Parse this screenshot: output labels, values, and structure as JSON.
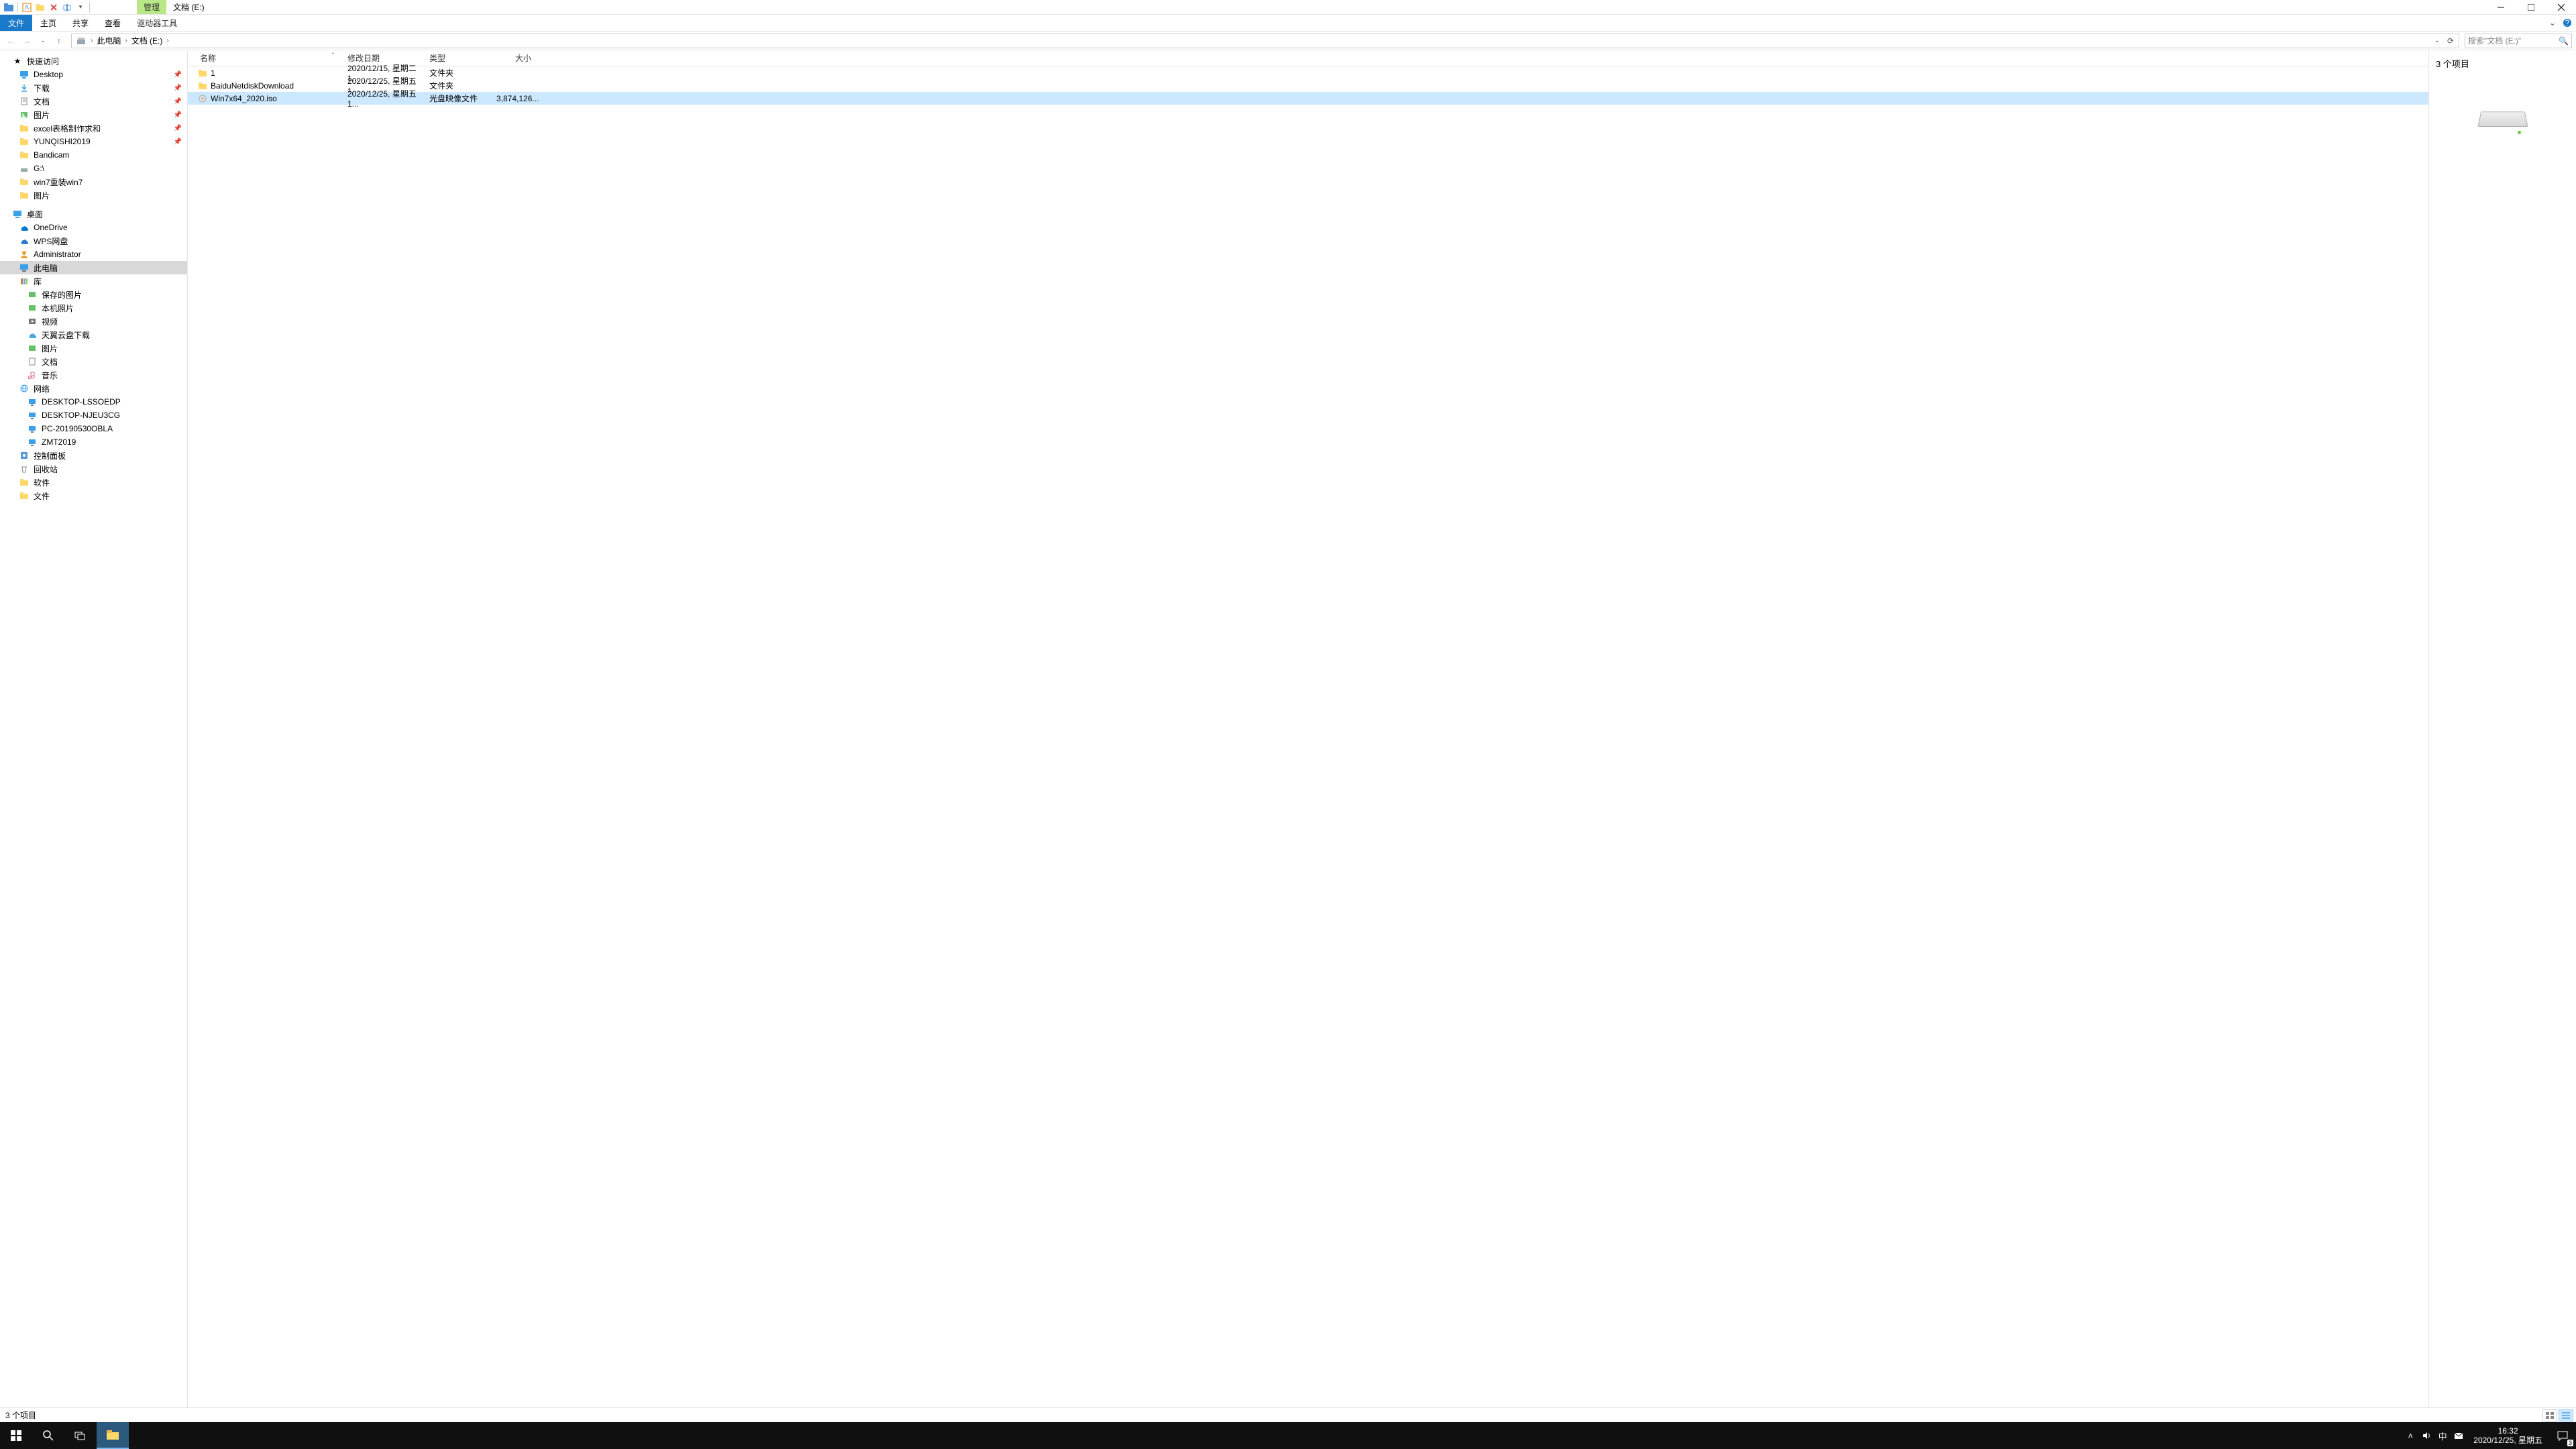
{
  "title": {
    "manage_tab": "管理",
    "location": "文档 (E:)"
  },
  "ribbon": {
    "file": "文件",
    "home": "主页",
    "share": "共享",
    "view": "查看",
    "drive_tools": "驱动器工具"
  },
  "breadcrumb": {
    "this_pc": "此电脑",
    "drive": "文档 (E:)"
  },
  "search": {
    "placeholder": "搜索\"文档 (E:)\""
  },
  "tree": {
    "quick_access": "快速访问",
    "desktop": "Desktop",
    "downloads": "下载",
    "documents": "文档",
    "pictures": "图片",
    "excel": "excel表格制作求和",
    "yunqishi": "YUNQISHI2019",
    "bandicam": "Bandicam",
    "gdrive": "G:\\",
    "win7": "win7重装win7",
    "pictures2": "图片",
    "desktop_cn": "桌面",
    "onedrive": "OneDrive",
    "wps": "WPS网盘",
    "admin": "Administrator",
    "this_pc": "此电脑",
    "library": "库",
    "saved_pics": "保存的图片",
    "local_photos": "本机照片",
    "video": "视频",
    "tianyi": "天翼云盘下载",
    "lib_pics": "图片",
    "lib_docs": "文档",
    "music": "音乐",
    "network": "网络",
    "pc1": "DESKTOP-LSSOEDP",
    "pc2": "DESKTOP-NJEU3CG",
    "pc3": "PC-20190530OBLA",
    "pc4": "ZMT2019",
    "cpanel": "控制面板",
    "recycle": "回收站",
    "soft": "软件",
    "files": "文件"
  },
  "columns": {
    "name": "名称",
    "date": "修改日期",
    "type": "类型",
    "size": "大小"
  },
  "rows": [
    {
      "name": "1",
      "date": "2020/12/15, 星期二 1...",
      "type": "文件夹",
      "size": "",
      "icon": "folder"
    },
    {
      "name": "BaiduNetdiskDownload",
      "date": "2020/12/25, 星期五 1...",
      "type": "文件夹",
      "size": "",
      "icon": "folder"
    },
    {
      "name": "Win7x64_2020.iso",
      "date": "2020/12/25, 星期五 1...",
      "type": "光盘映像文件",
      "size": "3,874,126...",
      "icon": "iso"
    }
  ],
  "preview": {
    "count": "3 个项目"
  },
  "status": {
    "count": "3 个项目"
  },
  "tray": {
    "ime": "中",
    "time": "16:32",
    "date": "2020/12/25, 星期五",
    "notif_count": "3"
  }
}
